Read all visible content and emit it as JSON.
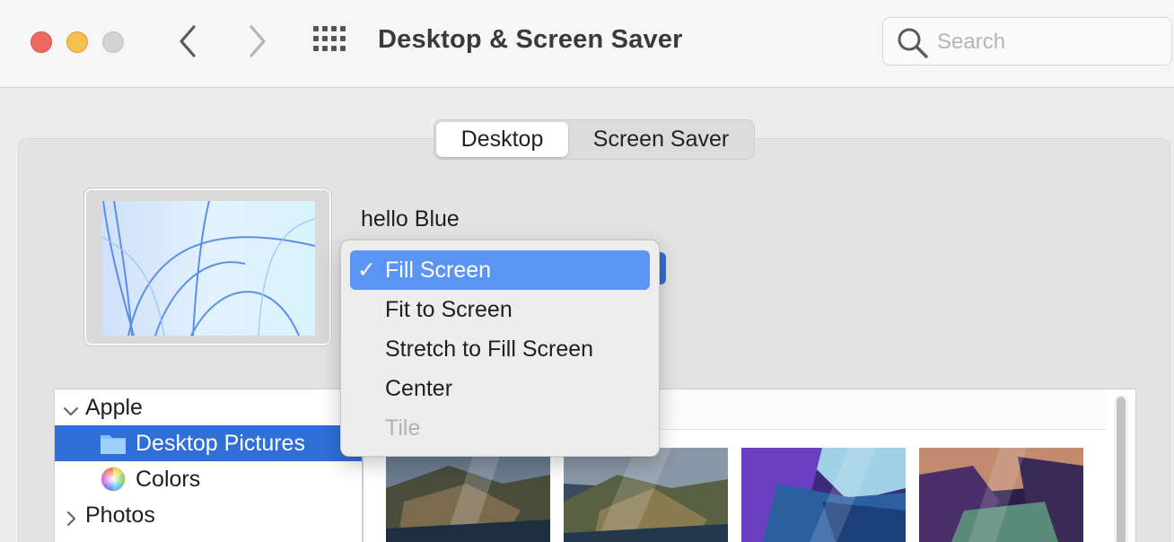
{
  "window": {
    "title": "Desktop & Screen Saver",
    "controls": [
      "close",
      "minimize",
      "zoom"
    ],
    "nav": {
      "back_icon": "chevron-left-icon",
      "forward_icon": "chevron-right-icon",
      "grid_icon": "grid-icon"
    },
    "search": {
      "placeholder": "Search",
      "value": ""
    }
  },
  "tabs": [
    {
      "label": "Desktop",
      "selected": true
    },
    {
      "label": "Screen Saver",
      "selected": false
    }
  ],
  "wallpaper": {
    "name": "hello Blue"
  },
  "fit_menu": {
    "items": [
      {
        "label": "Fill Screen",
        "checked": true,
        "highlighted": true,
        "enabled": true,
        "check_mark": "✓"
      },
      {
        "label": "Fit to Screen",
        "checked": false,
        "enabled": true
      },
      {
        "label": "Stretch to Fill Screen",
        "checked": false,
        "enabled": true
      },
      {
        "label": "Center",
        "checked": false,
        "enabled": true
      },
      {
        "label": "Tile",
        "checked": false,
        "enabled": false
      }
    ]
  },
  "sidebar": {
    "items": [
      {
        "label": "Apple",
        "type": "group",
        "expanded": true,
        "icon": "chevron-down-icon"
      },
      {
        "label": "Desktop Pictures",
        "type": "folder",
        "selected": true,
        "icon": "folder-icon"
      },
      {
        "label": "Colors",
        "type": "item",
        "selected": false,
        "icon": "color-wheel-icon"
      },
      {
        "label": "Photos",
        "type": "group",
        "expanded": false,
        "icon": "chevron-right-icon"
      }
    ]
  },
  "colors": {
    "accent": "#2f6fd8",
    "menu_highlight": "#5b95f3",
    "close": "#ed6a5e",
    "minimize": "#f5bf4f",
    "zoom_disabled": "#d3d3d3"
  }
}
